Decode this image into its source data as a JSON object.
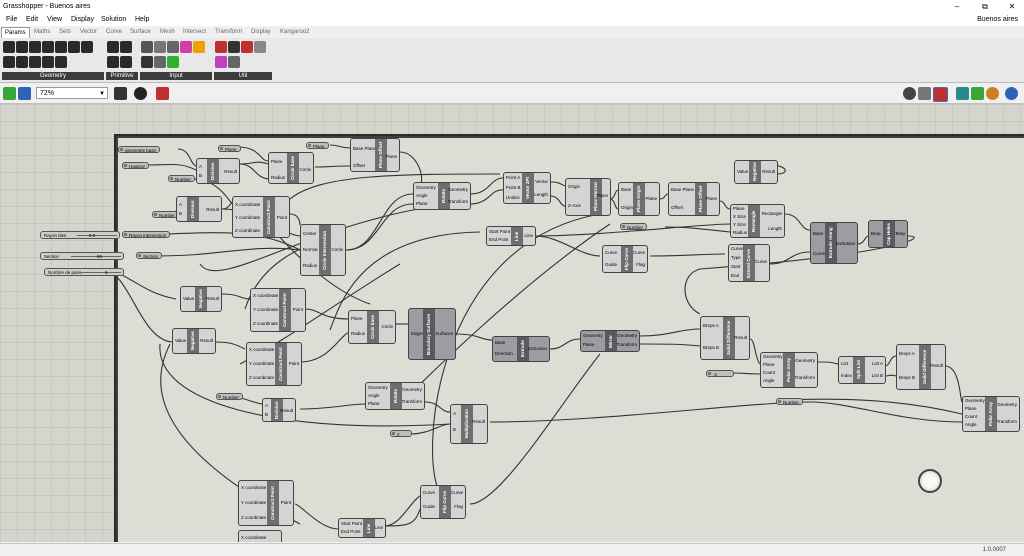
{
  "window": {
    "title": "Grasshopper - Buenos aires",
    "doc_name": "Buenos aires",
    "version": "1.0.0007"
  },
  "menu": [
    "File",
    "Edit",
    "View",
    "Display",
    "Solution",
    "Help"
  ],
  "tabs": [
    "Params",
    "Maths",
    "Sets",
    "Vector",
    "Curve",
    "Surface",
    "Mesh",
    "Intersect",
    "Transform",
    "Display",
    "Kangaroo2"
  ],
  "ribbon_groups": [
    "Geometry",
    "Primitive",
    "Input",
    "Util"
  ],
  "toolbar": {
    "zoom": "72%"
  },
  "sliders": [
    {
      "name": "Rayon tiles",
      "value": "8.0"
    },
    {
      "name": "Section",
      "value": "80"
    },
    {
      "name": "Nombre de pans",
      "value": "6"
    }
  ],
  "params": {
    "geometrie_base": "geometrie base",
    "plane": "Plane",
    "hauteur": "Hauteur",
    "number": "Number",
    "rayon_intersection": "Rayon intersection",
    "section": "Section",
    "number2": "Number",
    "number3": "Number",
    "number4": "Number",
    "num_2": "2",
    "num_neg2": "-2"
  },
  "components": {
    "division1": {
      "label": "Division",
      "inputs": [
        "A",
        "B"
      ],
      "outputs": [
        "Result"
      ]
    },
    "circle_base": {
      "label": "Circle base",
      "inputs": [
        "Plane",
        "Radius"
      ],
      "outputs": [
        "Circle"
      ]
    },
    "plane_offset1": {
      "label": "Plane Offset",
      "inputs": [
        "Base Plane",
        "Offset"
      ],
      "outputs": [
        "Plane"
      ]
    },
    "division2": {
      "label": "Division",
      "inputs": [
        "A",
        "B"
      ],
      "outputs": [
        "Result"
      ]
    },
    "construct_point1": {
      "label": "Construct Point",
      "inputs": [
        "X coordinate",
        "Y coordinate",
        "Z coordinate"
      ],
      "outputs": [
        "Point"
      ]
    },
    "circle_intersection": {
      "label": "Circle Intersection",
      "inputs": [
        "Center",
        "Normal",
        "Radius"
      ],
      "outputs": [
        "Circle"
      ]
    },
    "rotate1": {
      "label": "Rotate",
      "inputs": [
        "Geometry",
        "Angle",
        "Plane"
      ],
      "outputs": [
        "Geometry",
        "Transform"
      ]
    },
    "vector2pt": {
      "label": "Vector 2Pt",
      "inputs": [
        "Point A",
        "Point B",
        "Unitize"
      ],
      "outputs": [
        "Vector",
        "Length"
      ]
    },
    "plane_normal": {
      "label": "Plane Normal",
      "inputs": [
        "Origin",
        "Z-Axis"
      ],
      "outputs": [
        "Plane"
      ]
    },
    "plane_origin": {
      "label": "Plane Origin",
      "inputs": [
        "Base",
        "Origin"
      ],
      "outputs": [
        "Plane"
      ]
    },
    "plane_offset2": {
      "label": "Plane Offset",
      "inputs": [
        "Base Plane",
        "Offset"
      ],
      "outputs": [
        "Plane"
      ]
    },
    "negative1": {
      "label": "Negative",
      "inputs": [
        "Value"
      ],
      "outputs": [
        "Result"
      ]
    },
    "rectangle": {
      "label": "Rectangle",
      "inputs": [
        "Plane",
        "X Size",
        "Y Size",
        "Radius"
      ],
      "outputs": [
        "Rectangle",
        "Length"
      ]
    },
    "line1": {
      "label": "Line",
      "inputs": [
        "Start Point",
        "End Point"
      ],
      "outputs": [
        "Line"
      ]
    },
    "flip_curve1": {
      "label": "Flip Curve",
      "inputs": [
        "Curve",
        "Guide"
      ],
      "outputs": [
        "Curve",
        "Flag"
      ]
    },
    "extend_curve": {
      "label": "Extend Curve",
      "inputs": [
        "Curve",
        "Type",
        "Start",
        "End"
      ],
      "outputs": [
        "Curve"
      ]
    },
    "extrude_along": {
      "label": "Extrude Along",
      "inputs": [
        "Base",
        "Curve"
      ],
      "outputs": [
        "Extrusion"
      ]
    },
    "cap_holes": {
      "label": "Cap Holes",
      "inputs": [
        "Brep"
      ],
      "outputs": [
        "Brep"
      ]
    },
    "negative2": {
      "label": "Negative",
      "inputs": [
        "Value"
      ],
      "outputs": [
        "Result"
      ]
    },
    "construct_point2": {
      "label": "Construct Point",
      "inputs": [
        "X coordinate",
        "Y coordinate",
        "Z coordinate"
      ],
      "outputs": [
        "Point"
      ]
    },
    "circle_base2": {
      "label": "Circle base",
      "inputs": [
        "Plane",
        "Radius"
      ],
      "outputs": [
        "Circle"
      ]
    },
    "boundary_surfaces": {
      "label": "Boundary Surfaces",
      "inputs": [
        "Edges"
      ],
      "outputs": [
        "Surfaces"
      ]
    },
    "extrude": {
      "label": "Extrude",
      "inputs": [
        "Base",
        "Direction"
      ],
      "outputs": [
        "Extrusion"
      ]
    },
    "mirror": {
      "label": "Mirror",
      "inputs": [
        "Geometry",
        "Plane"
      ],
      "outputs": [
        "Geometry",
        "Transform"
      ]
    },
    "solid_difference1": {
      "label": "Solid Difference",
      "inputs": [
        "Breps A",
        "Breps B"
      ],
      "outputs": [
        "Result"
      ]
    },
    "negative3": {
      "label": "Negative",
      "inputs": [
        "Value"
      ],
      "outputs": [
        "Result"
      ]
    },
    "construct_point3": {
      "label": "Construct Point",
      "inputs": [
        "X coordinate",
        "Y coordinate",
        "Z coordinate"
      ],
      "outputs": [
        "Point"
      ]
    },
    "polar_array1": {
      "label": "Polar Array",
      "inputs": [
        "Geometry",
        "Plane",
        "Count",
        "Angle"
      ],
      "outputs": [
        "Geometry",
        "Transform"
      ]
    },
    "split_list": {
      "label": "Split List",
      "inputs": [
        "List",
        "Index"
      ],
      "outputs": [
        "List A",
        "List B"
      ]
    },
    "solid_difference2": {
      "label": "Solid Difference",
      "inputs": [
        "Breps A",
        "Breps B"
      ],
      "outputs": [
        "Result"
      ]
    },
    "rotate2": {
      "label": "Rotate",
      "inputs": [
        "Geometry",
        "Angle",
        "Plane"
      ],
      "outputs": [
        "Geometry",
        "Transform"
      ]
    },
    "division3": {
      "label": "Division",
      "inputs": [
        "A",
        "B"
      ],
      "outputs": [
        "Result"
      ]
    },
    "multiplication": {
      "label": "Multiplication",
      "inputs": [
        "A",
        "B"
      ],
      "outputs": [
        "Result"
      ]
    },
    "polar_array2": {
      "label": "Polar Array",
      "inputs": [
        "Geometry",
        "Plane",
        "Count",
        "Angle"
      ],
      "outputs": [
        "Geometry",
        "Transform"
      ]
    },
    "construct_point4": {
      "label": "Construct Point",
      "inputs": [
        "X coordinate",
        "Y coordinate",
        "Z coordinate"
      ],
      "outputs": [
        "Point"
      ]
    },
    "flip_curve2": {
      "label": "Flip Curve",
      "inputs": [
        "Curve",
        "Guide"
      ],
      "outputs": [
        "Curve",
        "Flag"
      ]
    },
    "line2": {
      "label": "Line",
      "inputs": [
        "Start Point",
        "End Point"
      ],
      "outputs": [
        "Line"
      ]
    },
    "construct_point5_partial": {
      "label": "",
      "inputs": [
        "X coordinate"
      ],
      "outputs": []
    }
  }
}
